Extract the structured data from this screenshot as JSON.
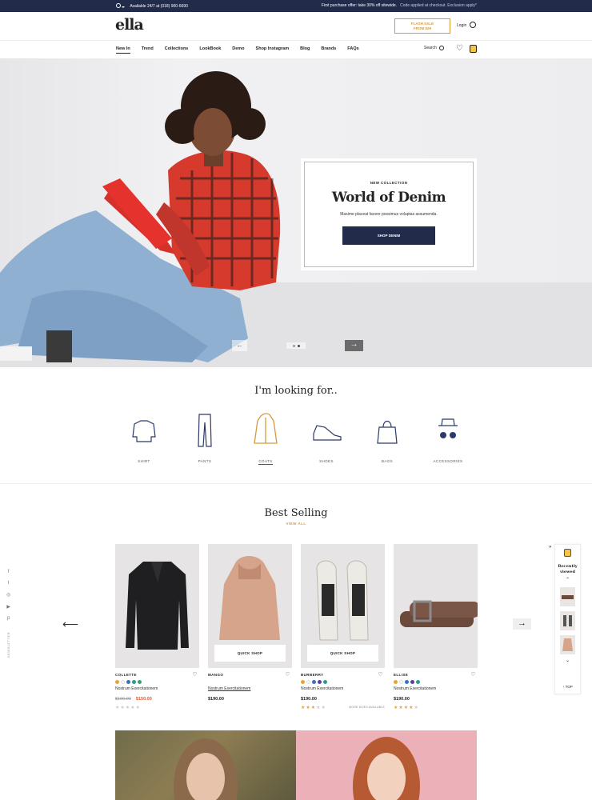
{
  "topbar": {
    "availability": "Available 24/7 at (018) 900-6690",
    "offer": "First purchase offer: take 30% off sitewide.",
    "offer_note": "Code applied at checkout. Exclusion apply*"
  },
  "header": {
    "logo": "ella",
    "flash_line1": "FLASH SALE",
    "flash_line2": "FROM $29",
    "login": "Login"
  },
  "nav": {
    "items": [
      "New In",
      "Trend",
      "Collections",
      "LookBook",
      "Demo",
      "Shop Instagram",
      "Blog",
      "Brands",
      "FAQs"
    ],
    "search": "Search"
  },
  "hero": {
    "kicker": "NEW COLLECTION",
    "title": "World of Denim",
    "text": "Maxime placeat facere possimus voluptas assumenda.",
    "button": "SHOP DENIM",
    "slide_index": 2,
    "slide_count": 2
  },
  "looking": {
    "title": "I'm looking for..",
    "categories": [
      {
        "label": "SHIRT",
        "icon": "shirt-icon"
      },
      {
        "label": "PANTS",
        "icon": "pants-icon"
      },
      {
        "label": "COATS",
        "icon": "coat-icon"
      },
      {
        "label": "SHOES",
        "icon": "shoe-icon"
      },
      {
        "label": "BAGS",
        "icon": "bag-icon"
      },
      {
        "label": "ACCESSORIES",
        "icon": "hat-glasses-icon"
      }
    ]
  },
  "best": {
    "title": "Best Selling",
    "view_all": "VIEW ALL",
    "products": [
      {
        "brand": "COLLETTE",
        "name": "Nostrum Exercitationem",
        "old_price": "$190.00",
        "price": "$150.00",
        "rating": 0,
        "quick_shop": "",
        "swatches": [
          "#e8a33b",
          "#ffffff",
          "#3e6fb8",
          "#2f9a8e",
          "#3c9f6e"
        ]
      },
      {
        "brand": "MANGO",
        "name": "Nostrum Exercitationem",
        "old_price": "",
        "price": "$190.00",
        "rating": 0,
        "quick_shop": "QUICK SHOP",
        "swatches": []
      },
      {
        "brand": "BURBERRY",
        "name": "Nostrum Exercitationem",
        "old_price": "",
        "price": "$190.00",
        "rating": 3,
        "quick_shop": "QUICK SHOP",
        "more_sizes": "MORE SIZES AVAILABLE",
        "swatches": [
          "#e8a33b",
          "#ffffff",
          "#3e6fb8",
          "#5a3fa2",
          "#2f9a8e"
        ]
      },
      {
        "brand": "ELLISE",
        "name": "Nostrum Exercitationem",
        "old_price": "",
        "price": "$190.00",
        "rating": 4,
        "quick_shop": "",
        "swatches": [
          "#e8a33b",
          "#ffffff",
          "#3e6fb8",
          "#5a3fa2",
          "#2f9a8e"
        ]
      }
    ]
  },
  "social": {
    "newsletter": "NEWSLETTER"
  },
  "recent": {
    "title_line1": "Recently",
    "title_line2": "viewed",
    "top": "TOP"
  },
  "colors": {
    "navy": "#232b4b",
    "accent": "#d79a3b",
    "sale": "#e4572e"
  }
}
